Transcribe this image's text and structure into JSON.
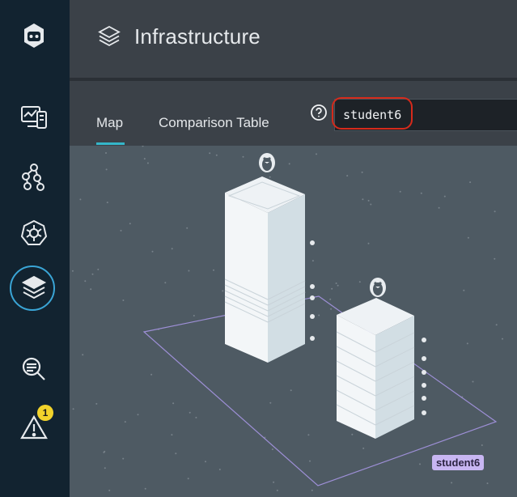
{
  "header": {
    "title": "Infrastructure",
    "icon": "layers-icon"
  },
  "nav": {
    "items": [
      {
        "name": "logo",
        "icon": "robot-logo-icon"
      },
      {
        "name": "dashboards",
        "icon": "dashboard-devices-icon"
      },
      {
        "name": "services",
        "icon": "service-graph-icon"
      },
      {
        "name": "kubernetes",
        "icon": "kubernetes-icon"
      },
      {
        "name": "infrastructure",
        "icon": "layers-icon",
        "active": true
      },
      {
        "name": "logs",
        "icon": "log-search-icon"
      },
      {
        "name": "alerts",
        "icon": "alert-triangle-icon",
        "badge": "1"
      }
    ]
  },
  "tabs": [
    {
      "label": "Map",
      "active": true
    },
    {
      "label": "Comparison Table",
      "active": false
    }
  ],
  "search": {
    "value": "student6",
    "help_icon": "question-circle-icon"
  },
  "map": {
    "namespace_label": "student6"
  },
  "colors": {
    "accent": "#34b6c9",
    "highlight": "#d62a1b",
    "label_bg": "#c8b6f2"
  }
}
